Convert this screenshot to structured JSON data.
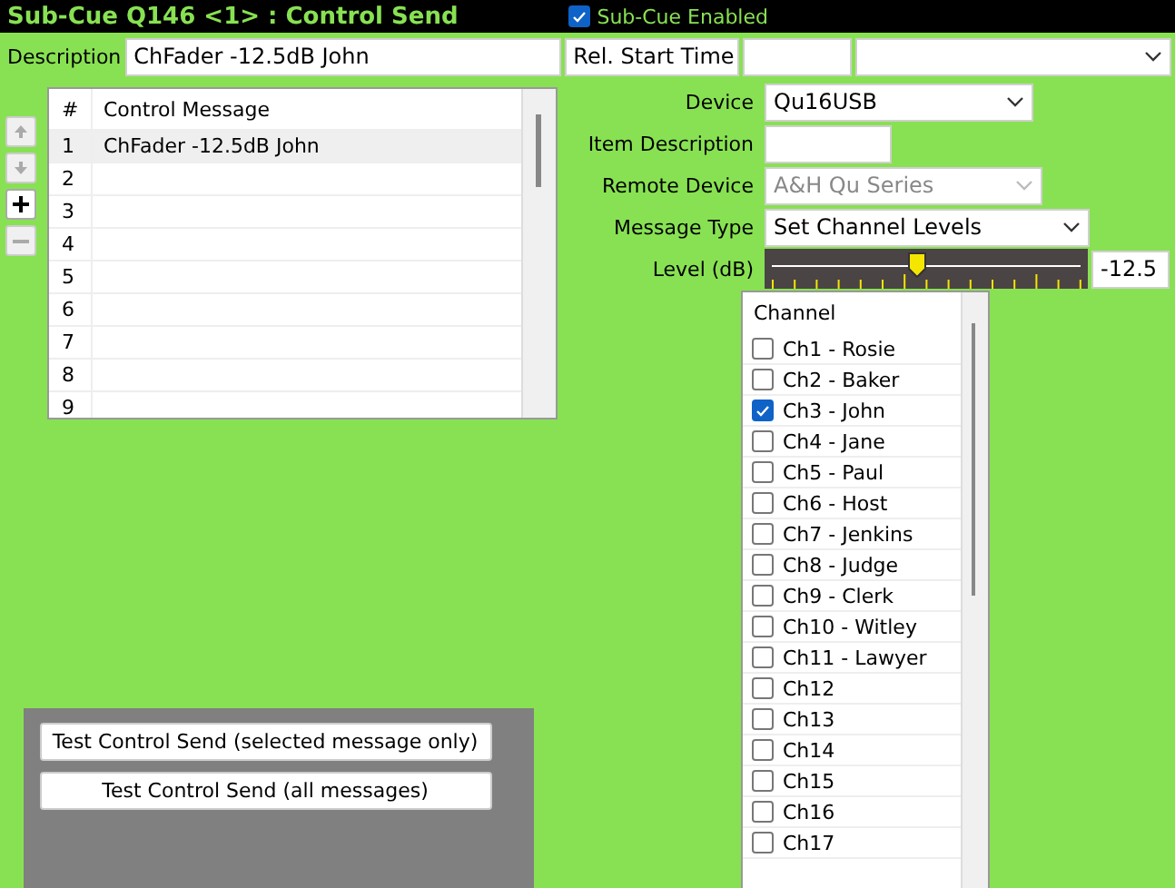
{
  "header": {
    "title": "Sub-Cue Q146 <1> : Control Send",
    "subcue_enabled": {
      "label": "Sub-Cue Enabled",
      "checked": true
    }
  },
  "description": {
    "label": "Description",
    "value": "ChFader -12.5dB John"
  },
  "start_time": {
    "mode": "Rel. Start Time"
  },
  "move_buttons": [
    {
      "kind": "up",
      "disabled": true
    },
    {
      "kind": "down",
      "disabled": true
    },
    {
      "kind": "add",
      "disabled": false
    },
    {
      "kind": "remove",
      "disabled": true
    }
  ],
  "table": {
    "columns": [
      "#",
      "Control Message"
    ],
    "rows": [
      {
        "num": "1",
        "message": "ChFader -12.5dB John",
        "selected": true
      },
      {
        "num": "2",
        "message": "",
        "selected": false
      },
      {
        "num": "3",
        "message": "",
        "selected": false
      },
      {
        "num": "4",
        "message": "",
        "selected": false
      },
      {
        "num": "5",
        "message": "",
        "selected": false
      },
      {
        "num": "6",
        "message": "",
        "selected": false
      },
      {
        "num": "7",
        "message": "",
        "selected": false
      },
      {
        "num": "8",
        "message": "",
        "selected": false
      },
      {
        "num": "9",
        "message": "",
        "selected": false
      }
    ]
  },
  "test_buttons": [
    "Test Control Send (selected message only)",
    "Test Control Send (all messages)"
  ],
  "form": {
    "device": {
      "label": "Device",
      "value": "Qu16USB"
    },
    "item_description": {
      "label": "Item Description"
    },
    "remote_device": {
      "label": "Remote Device",
      "value": "A&H Qu Series",
      "disabled": true
    },
    "message_type": {
      "label": "Message Type",
      "value": "Set Channel Levels"
    },
    "level": {
      "label": "Level (dB)",
      "level": 0.47,
      "reading": "-12.5"
    }
  },
  "channels": {
    "header": "Channel",
    "items": [
      {
        "label": "Ch1 - Rosie",
        "checked": false
      },
      {
        "label": "Ch2 - Baker",
        "checked": false
      },
      {
        "label": "Ch3 - John",
        "checked": true
      },
      {
        "label": "Ch4 - Jane",
        "checked": false
      },
      {
        "label": "Ch5 - Paul",
        "checked": false
      },
      {
        "label": "Ch6 - Host",
        "checked": false
      },
      {
        "label": "Ch7 - Jenkins",
        "checked": false
      },
      {
        "label": "Ch8 - Judge",
        "checked": false
      },
      {
        "label": "Ch9 - Clerk",
        "checked": false
      },
      {
        "label": "Ch10 - Witley",
        "checked": false
      },
      {
        "label": "Ch11 - Lawyer",
        "checked": false
      },
      {
        "label": "Ch12",
        "checked": false
      },
      {
        "label": "Ch13",
        "checked": false
      },
      {
        "label": "Ch14",
        "checked": false
      },
      {
        "label": "Ch15",
        "checked": false
      },
      {
        "label": "Ch16",
        "checked": false
      },
      {
        "label": "Ch17",
        "checked": false
      }
    ]
  }
}
